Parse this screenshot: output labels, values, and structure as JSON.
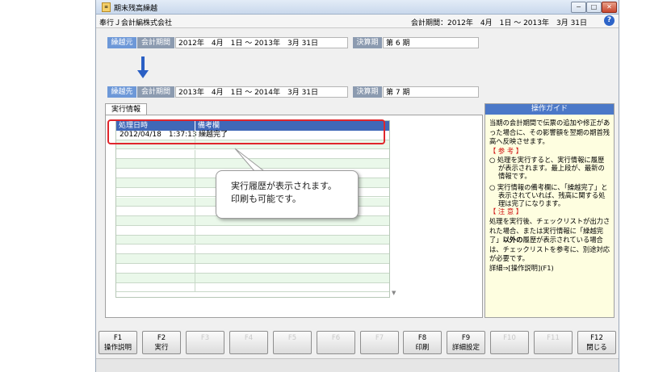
{
  "window": {
    "title": "期末残高繰越",
    "min_label": "−",
    "max_label": "□",
    "close_label": "✕"
  },
  "infobar": {
    "company": "奉行Ｊ会計編株式会社",
    "period": "会計期間：2012年　4月　1日 ～ 2013年　3月 31日"
  },
  "source": {
    "tag": "繰越元",
    "period_label": "会計期間",
    "period_value": "2012年　4月　1日 ～ 2013年　3月 31日",
    "term_label": "決算期",
    "term_value": "第 6 期"
  },
  "destination": {
    "tag": "繰越先",
    "period_label": "会計期間",
    "period_value": "2013年　4月　1日 ～ 2014年　3月 31日",
    "term_label": "決算期",
    "term_value": "第 7 期"
  },
  "tab": {
    "label": "実行情報"
  },
  "table": {
    "columns": [
      "処理日時",
      "備考欄"
    ],
    "rows": [
      [
        "2012/04/18　1:37:13",
        "繰越完了"
      ],
      [
        "",
        ""
      ],
      [
        "",
        ""
      ],
      [
        "",
        ""
      ],
      [
        "",
        ""
      ],
      [
        "",
        ""
      ],
      [
        "",
        ""
      ],
      [
        "",
        ""
      ],
      [
        "",
        ""
      ],
      [
        "",
        ""
      ],
      [
        "",
        ""
      ],
      [
        "",
        ""
      ],
      [
        "",
        ""
      ],
      [
        "",
        ""
      ],
      [
        "",
        ""
      ],
      [
        "",
        ""
      ],
      [
        "",
        ""
      ]
    ]
  },
  "callout": {
    "line1": "実行履歴が表示されます。",
    "line2": "印刷も可能です。"
  },
  "guide": {
    "header": "操作ガイド",
    "intro": "当期の会計期間で伝票の追加や修正があった場合に、その影響額を翌期の期首残高へ反映させます。",
    "ref_heading": "【 参 考 】",
    "ref1": "○ 処理を実行すると、実行情報に履歴が表示されます。最上段が、最新の情報です。",
    "ref2": "○ 実行情報の備考欄に、「繰越完了」と表示されていれば、残高に関する処理は完了になります。",
    "note_heading": "【 注 意 】",
    "note_a": "処理を実行後、チェックリストが出力された場合、または実行情報に「繰越完了」",
    "note_bold": "以外の",
    "note_b": "履歴が表示されている場合は、チェックリストを参考に、別途対応が必要です。",
    "details": "詳細⇒[操作説明](F1)"
  },
  "fkeys": [
    {
      "key": "F1",
      "label": "操作説明",
      "enabled": true
    },
    {
      "key": "F2",
      "label": "実行",
      "enabled": true
    },
    {
      "key": "F3",
      "label": "",
      "enabled": false
    },
    {
      "key": "F4",
      "label": "",
      "enabled": false
    },
    {
      "key": "F5",
      "label": "",
      "enabled": false
    },
    {
      "key": "F6",
      "label": "",
      "enabled": false
    },
    {
      "key": "F7",
      "label": "",
      "enabled": false
    },
    {
      "key": "F8",
      "label": "印刷",
      "enabled": true
    },
    {
      "key": "F9",
      "label": "詳細設定",
      "enabled": true
    },
    {
      "key": "F10",
      "label": "",
      "enabled": false
    },
    {
      "key": "F11",
      "label": "",
      "enabled": false
    },
    {
      "key": "F12",
      "label": "閉じる",
      "enabled": true
    }
  ],
  "colors": {
    "accent_blue": "#4b78c8",
    "highlight_red": "#e0262c",
    "guide_bg": "#fefee0"
  }
}
